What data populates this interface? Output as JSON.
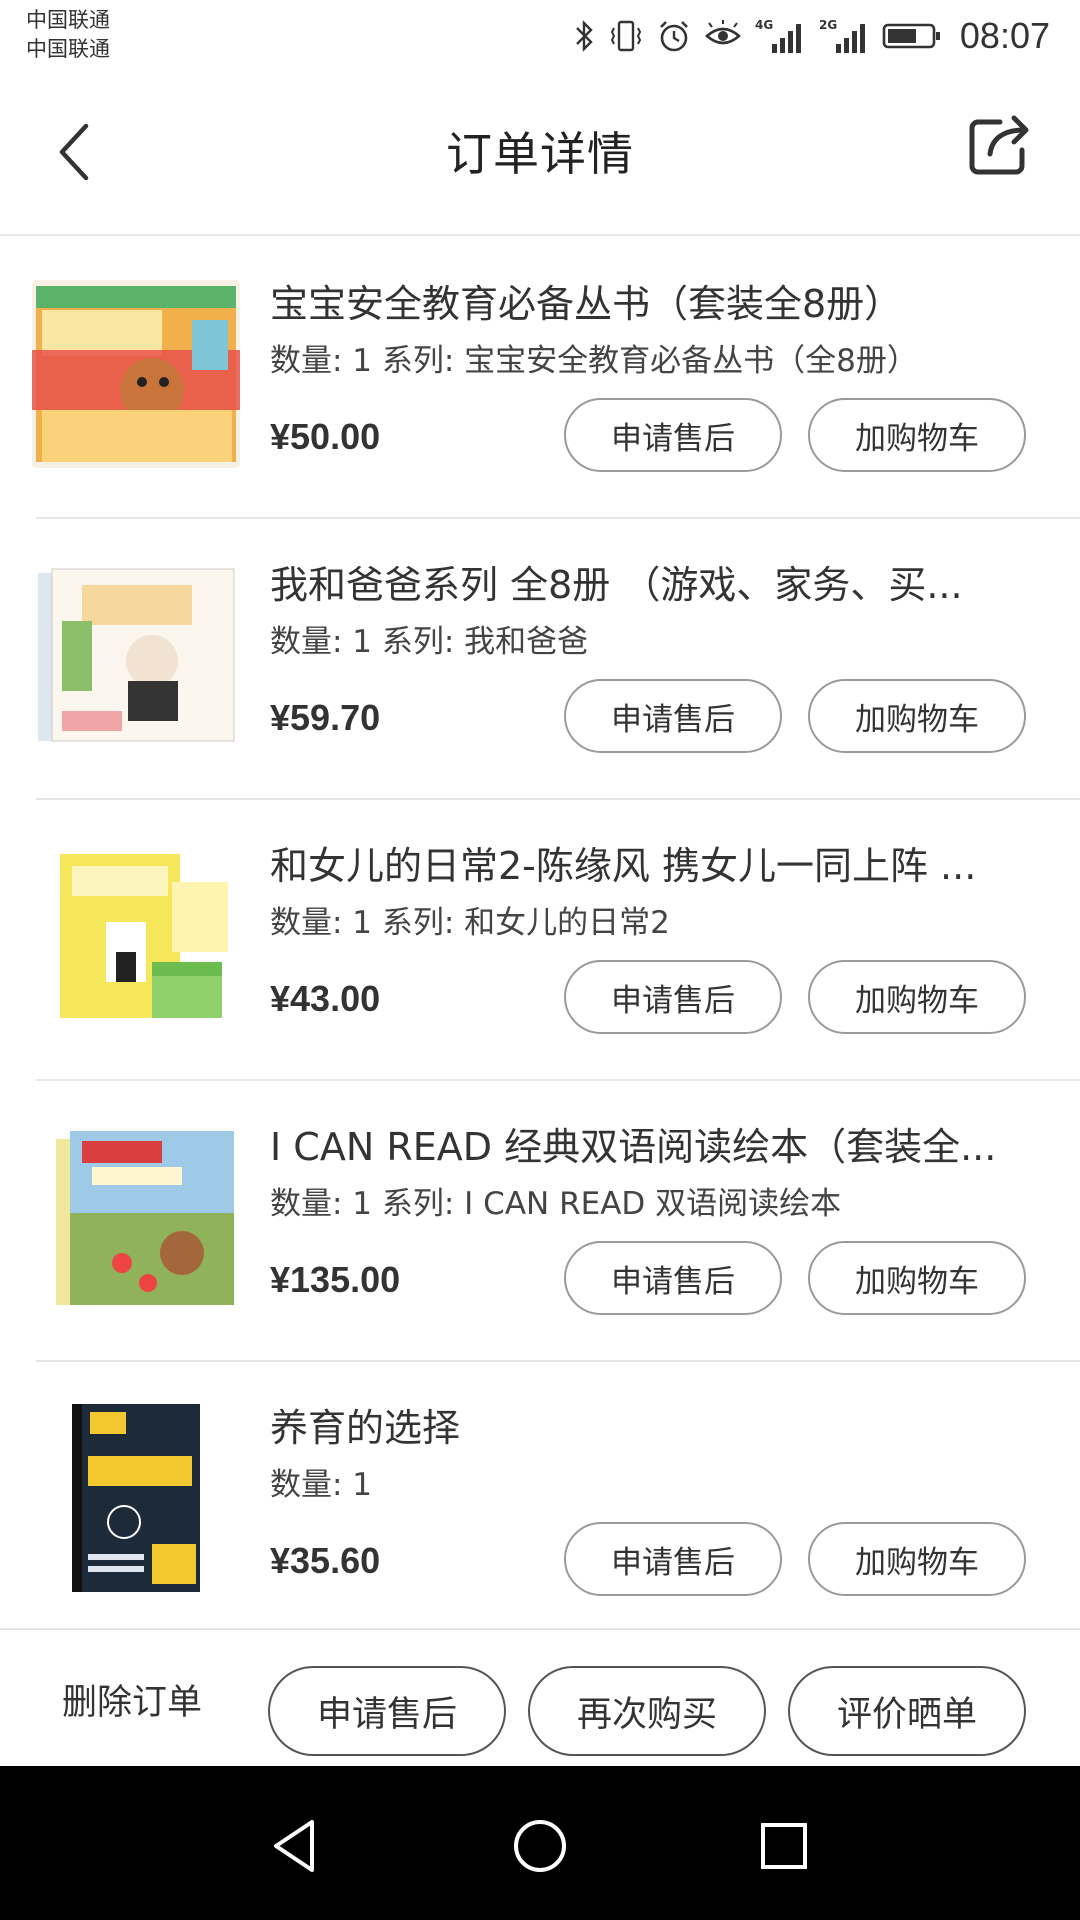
{
  "status_bar": {
    "carrier_1": "中国联通",
    "carrier_2": "中国联通",
    "signal_1_label": "4G",
    "signal_2_label": "2G",
    "time": "08:07",
    "icons": [
      "bluetooth-icon",
      "vibrate-icon",
      "alarm-icon",
      "eye-icon",
      "signal-4g-icon",
      "signal-2g-icon",
      "battery-icon"
    ]
  },
  "header": {
    "title": "订单详情",
    "back_icon": "chevron-left-icon",
    "share_icon": "share-icon"
  },
  "items": [
    {
      "title": "宝宝安全教育必备丛书（套装全8册）",
      "subtitle": "数量: 1 系列: 宝宝安全教育必备丛书（全8册）",
      "price": "¥50.00",
      "after_sale_label": "申请售后",
      "add_cart_label": "加购物车"
    },
    {
      "title": "我和爸爸系列 全8册 （游戏、家务、买...",
      "subtitle": "数量: 1 系列: 我和爸爸",
      "price": "¥59.70",
      "after_sale_label": "申请售后",
      "add_cart_label": "加购物车"
    },
    {
      "title": "和女儿的日常2-陈缘风 携女儿一同上阵 ...",
      "subtitle": "数量: 1 系列: 和女儿的日常2",
      "price": "¥43.00",
      "after_sale_label": "申请售后",
      "add_cart_label": "加购物车"
    },
    {
      "title": "I CAN READ 经典双语阅读绘本（套装全...",
      "subtitle": "数量: 1 系列: I CAN READ 双语阅读绘本",
      "price": "¥135.00",
      "after_sale_label": "申请售后",
      "add_cart_label": "加购物车"
    },
    {
      "title": "养育的选择",
      "subtitle": "数量: 1",
      "price": "¥35.60",
      "after_sale_label": "申请售后",
      "add_cart_label": "加购物车"
    }
  ],
  "bottom_bar": {
    "delete_label": "删除订单",
    "after_sale_label": "申请售后",
    "buy_again_label": "再次购买",
    "review_label": "评价晒单"
  },
  "nav_bar": {
    "icons": [
      "back-triangle-icon",
      "home-circle-icon",
      "recents-square-icon"
    ]
  }
}
